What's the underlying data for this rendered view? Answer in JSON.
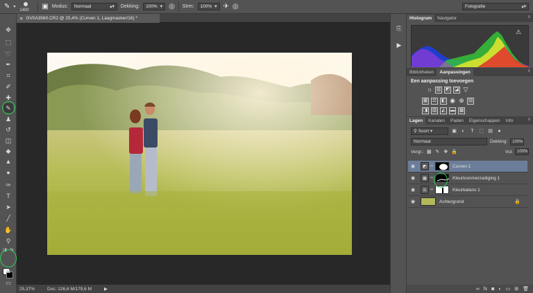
{
  "options": {
    "brush_size": "1400",
    "mode_label": "Modus:",
    "mode_value": "Normaal",
    "opacity_label": "Dekking:",
    "opacity_value": "100%",
    "flow_label": "Strm:",
    "flow_value": "100%",
    "workspace": "Fotografie"
  },
  "document": {
    "tab_title": "GV0A3560.CR2 @ 25,4% (Curven 1, Laagmasker/16) *",
    "zoom": "25,37%",
    "doc_info": "Doc: 126,6 M/179,6 M"
  },
  "panels": {
    "histogram_tabs": [
      "Histogram",
      "Navigator"
    ],
    "adjust_tabs": [
      "Bibliotheken",
      "Aanpassingen"
    ],
    "adjust_title": "Een aanpassing toevoegen",
    "layer_tabs": [
      "Lagen",
      "Kanalen",
      "Paden",
      "Eigenschappen",
      "Info"
    ],
    "kind_label": "Soort",
    "blend_mode": "Normaal",
    "opacity_label": "Dekking:",
    "opacity_value": "100%",
    "lock_label": "Vergr.:",
    "fill_label": "Vul:",
    "fill_value": "100%",
    "layers": [
      {
        "name": "Curven 1",
        "selected": true
      },
      {
        "name": "Kleurtoon/verzadiging 1",
        "selected": false
      },
      {
        "name": "Kleurbalans 1",
        "selected": false
      },
      {
        "name": "Achtergrond",
        "selected": false
      }
    ]
  },
  "colors": {
    "highlight": "#2fcf5b",
    "selected_layer": "#6b7d99"
  }
}
